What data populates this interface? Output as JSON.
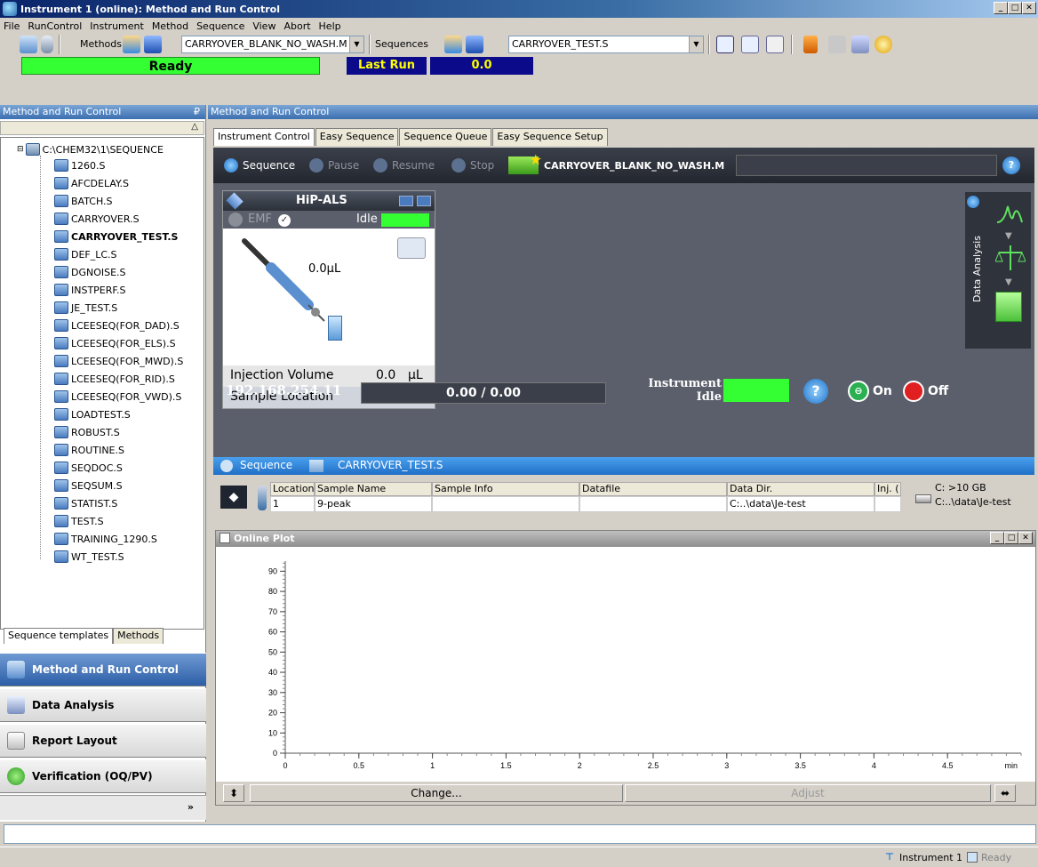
{
  "window": {
    "title": "Instrument 1 (online): Method and Run Control",
    "controls": [
      "_",
      "□",
      "✕"
    ]
  },
  "menu": [
    "File",
    "RunControl",
    "Instrument",
    "Method",
    "Sequence",
    "View",
    "Abort",
    "Help"
  ],
  "toolbar": {
    "methods_label": "Methods",
    "method_value": "CARRYOVER_BLANK_NO_WASH.M",
    "sequences_label": "Sequences",
    "sequence_value": "CARRYOVER_TEST.S"
  },
  "status": {
    "ready": "Ready",
    "last_run_label": "Last Run",
    "last_run_value": "0.0"
  },
  "left": {
    "header": "Method and Run Control",
    "pin": "₽",
    "root": "C:\\CHEM32\\1\\SEQUENCE",
    "items": [
      "1260.S",
      "AFCDELAY.S",
      "BATCH.S",
      "CARRYOVER.S",
      "CARRYOVER_TEST.S",
      "DEF_LC.S",
      "DGNOISE.S",
      "INSTPERF.S",
      "JE_TEST.S",
      "LCEESEQ(FOR_DAD).S",
      "LCEESEQ(FOR_ELS).S",
      "LCEESEQ(FOR_MWD).S",
      "LCEESEQ(FOR_RID).S",
      "LCEESEQ(FOR_VWD).S",
      "LOADTEST.S",
      "ROBUST.S",
      "ROUTINE.S",
      "SEQDOC.S",
      "SEQSUM.S",
      "STATIST.S",
      "TEST.S",
      "TRAINING_1290.S",
      "WT_TEST.S"
    ],
    "tabs": [
      "Sequence templates",
      "Methods"
    ],
    "nav": [
      "Method and Run Control",
      "Data Analysis",
      "Report Layout",
      "Verification (OQ/PV)"
    ],
    "more": "»"
  },
  "right": {
    "header": "Method and Run Control",
    "tabs": [
      "Instrument Control",
      "Easy Sequence",
      "Sequence Queue",
      "Easy Sequence Setup"
    ],
    "seqbar": {
      "sequence": "Sequence",
      "pause": "Pause",
      "resume": "Resume",
      "stop": "Stop",
      "method": "CARRYOVER_BLANK_NO_WASH.M",
      "help": "?"
    },
    "module": {
      "name": "HiP-ALS",
      "emf": "EMF",
      "state": "Idle",
      "volume": "0.0µL",
      "inj_label": "Injection Volume",
      "inj_value": "0.0",
      "inj_unit": "µL",
      "sample_loc": "Sample Location"
    },
    "ip": "192.168.254.11",
    "progress": "0.00 / 0.00",
    "inst_state_1": "Instrument",
    "inst_state_2": "Idle",
    "on_label": "On",
    "off_label": "Off",
    "data_analysis": "Data Analysis",
    "help": "?"
  },
  "sequence": {
    "label": "Sequence",
    "name": "CARRYOVER_TEST.S",
    "columns": [
      "Location",
      "Sample Name",
      "Sample Info",
      "Datafile",
      "Data Dir.",
      "Inj. ("
    ],
    "row": [
      "1",
      "9-peak",
      "",
      "",
      "C:..\\data\\Je-test",
      ""
    ],
    "disk1": "C: >10 GB",
    "disk2": "C:..\\data\\Je-test"
  },
  "plot": {
    "title": "Online Plot",
    "change": "Change...",
    "adjust": "Adjust",
    "yticks": [
      "90",
      "80",
      "70",
      "60",
      "50",
      "40",
      "30",
      "20",
      "10",
      "0"
    ],
    "xticks": [
      "0",
      "0.5",
      "1",
      "1.5",
      "2",
      "2.5",
      "3",
      "3.5",
      "4",
      "4.5",
      "min"
    ]
  },
  "chart_data": {
    "type": "line",
    "xlim": [
      0,
      5
    ],
    "ylim": [
      0,
      95
    ],
    "xticks": [
      "0",
      "0.5",
      "1",
      "1.5",
      "2",
      "2.5",
      "3",
      "3.5",
      "4",
      "4.5"
    ],
    "yticks": [
      "0",
      "10",
      "20",
      "30",
      "40",
      "50",
      "60",
      "70",
      "80",
      "90"
    ],
    "xlabel": "min",
    "series": []
  },
  "statusbar": {
    "instrument": "Instrument 1",
    "state": "Ready"
  }
}
